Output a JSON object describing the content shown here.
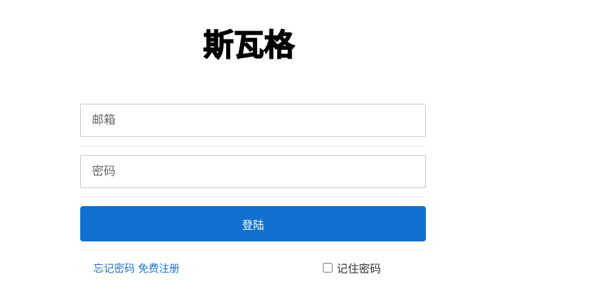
{
  "brand": {
    "logo_text": "斯瓦格"
  },
  "form": {
    "email_placeholder": "邮箱",
    "password_placeholder": "密码",
    "login_label": "登陆"
  },
  "footer": {
    "forgot_password": "忘记密码",
    "register": "免费注册",
    "remember_password": "记住密码",
    "remember_checked": false
  },
  "colors": {
    "primary_button": "#1270cf",
    "link": "#1f72c9",
    "input_border": "#c8c8c8"
  }
}
